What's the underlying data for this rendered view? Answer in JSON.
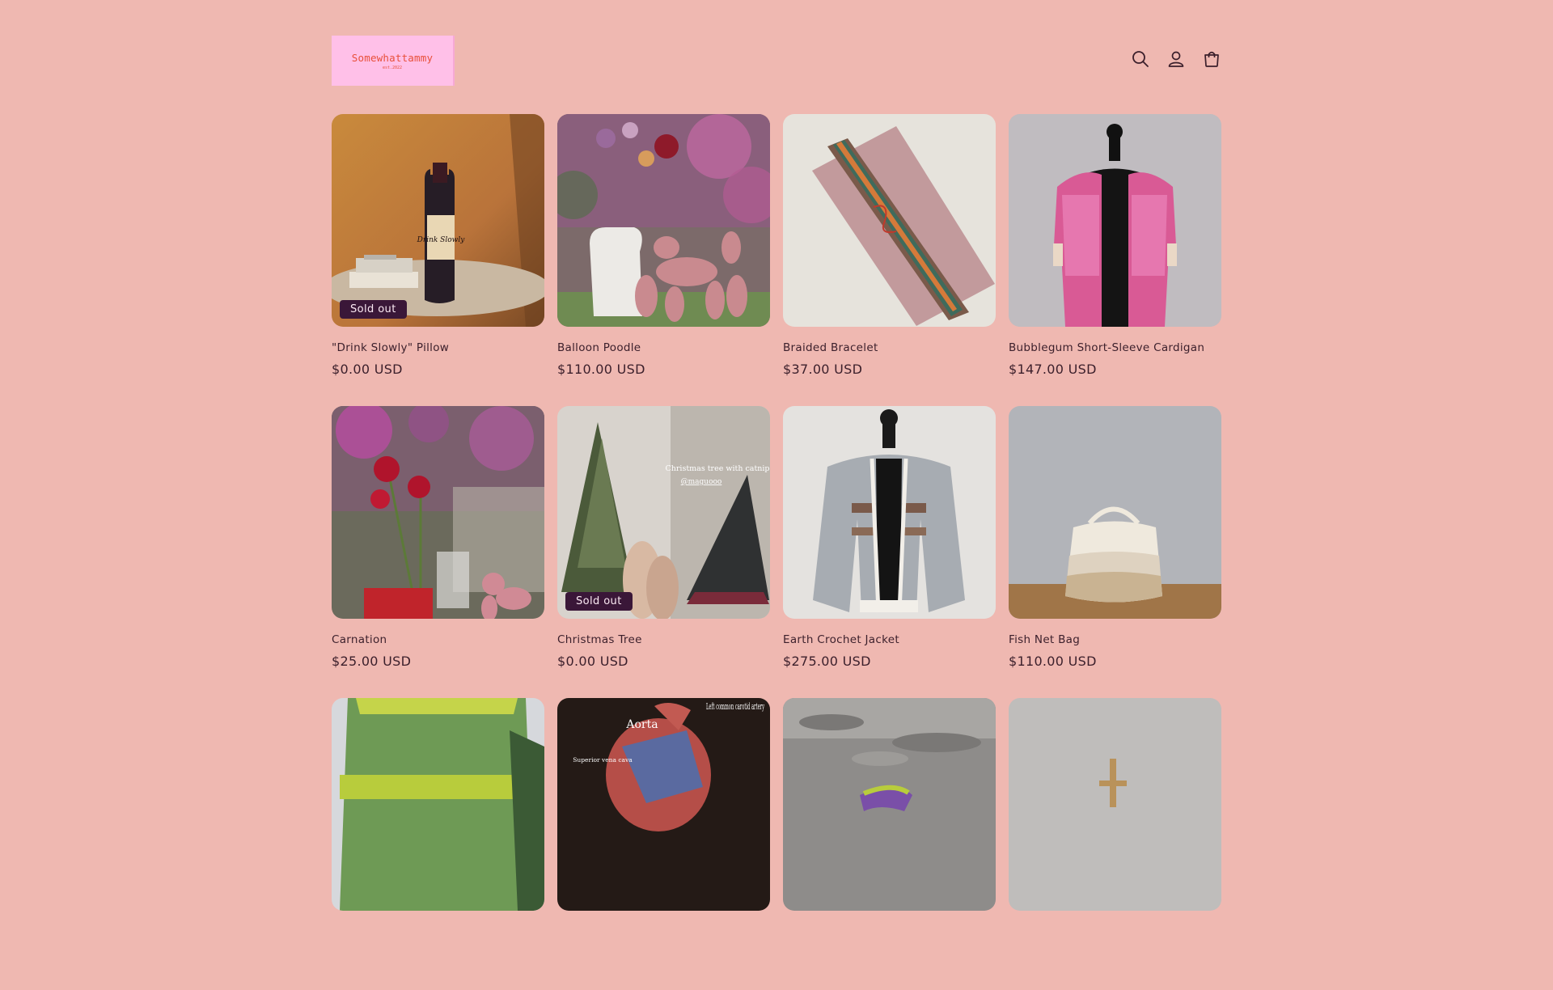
{
  "header": {
    "logo_name": "Somewhattammy",
    "logo_est": "est.2022",
    "icons": [
      "search-icon",
      "account-icon",
      "cart-icon"
    ]
  },
  "products": [
    {
      "title": "\"Drink Slowly\" Pillow",
      "price": "$0.00 USD",
      "badge": "Sold out"
    },
    {
      "title": "Balloon Poodle",
      "price": "$110.00 USD",
      "badge": ""
    },
    {
      "title": "Braided Bracelet",
      "price": "$37.00 USD",
      "badge": ""
    },
    {
      "title": "Bubblegum Short-Sleeve Cardigan",
      "price": "$147.00 USD",
      "badge": ""
    },
    {
      "title": "Carnation",
      "price": "$25.00 USD",
      "badge": ""
    },
    {
      "title": "Christmas Tree",
      "price": "$0.00 USD",
      "badge": "Sold out"
    },
    {
      "title": "Earth Crochet Jacket",
      "price": "$275.00 USD",
      "badge": ""
    },
    {
      "title": "Fish Net Bag",
      "price": "$110.00 USD",
      "badge": ""
    },
    {
      "title": "",
      "price": "",
      "badge": ""
    },
    {
      "title": "",
      "price": "",
      "badge": ""
    },
    {
      "title": "",
      "price": "",
      "badge": ""
    },
    {
      "title": "",
      "price": "",
      "badge": ""
    }
  ],
  "image_text": {
    "pillow_label": "Drink Slowly",
    "tree_caption": "Christmas tree with catnip",
    "tree_handle": "@maguooo",
    "heart_aorta": "Aorta",
    "heart_artery": "Left common carotid artery",
    "heart_vena": "Superior vena cava"
  },
  "colors": {
    "background": "#efb8b1",
    "logo_bg": "#ffc0e8",
    "logo_text": "#e8503a",
    "badge_bg": "#3a1738",
    "text": "#3b1f2b"
  }
}
